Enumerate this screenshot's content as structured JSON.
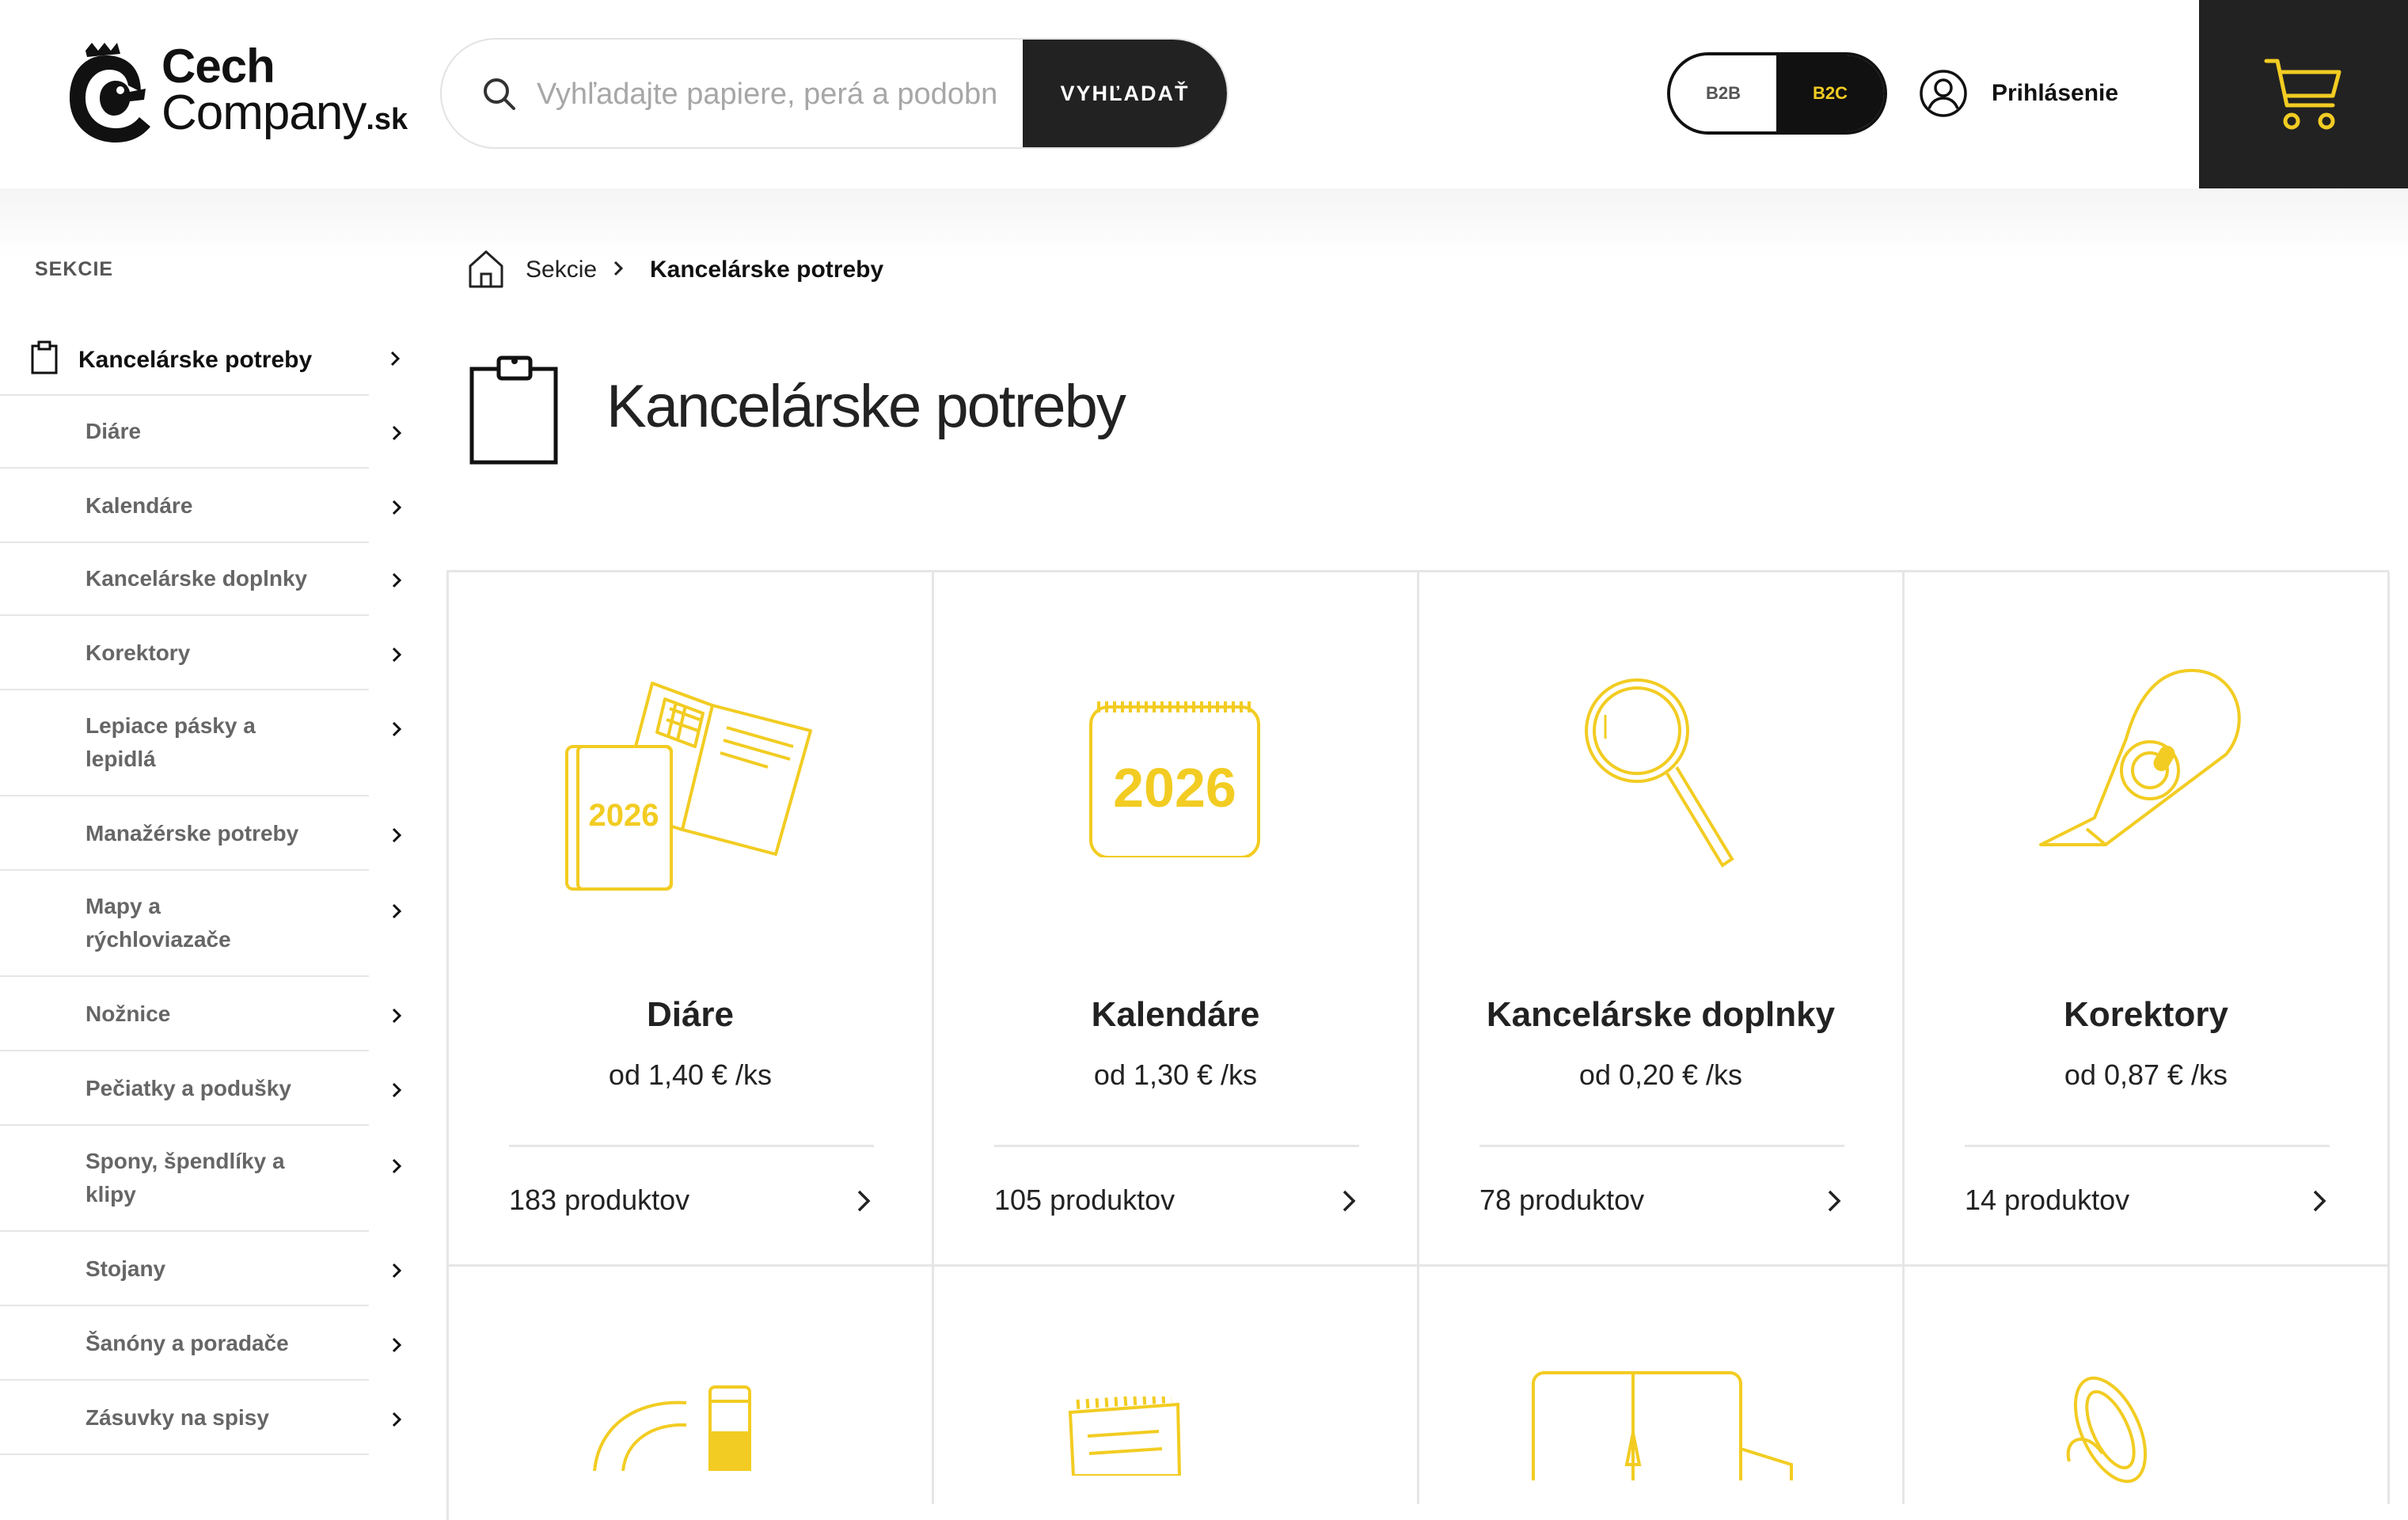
{
  "header": {
    "logo_line1": "Cech",
    "logo_line2": "Company",
    "logo_tld": ".sk",
    "search_placeholder": "Vyhľadajte papiere, perá a podobné",
    "search_button": "VYHĽADAŤ",
    "toggle_b2b": "B2B",
    "toggle_b2c": "B2C",
    "login_label": "Prihlásenie"
  },
  "sidebar": {
    "title": "SEKCIE",
    "active": "Kancelárske potreby",
    "items": [
      {
        "label": "Diáre"
      },
      {
        "label": "Kalendáre"
      },
      {
        "label": "Kancelárske doplnky"
      },
      {
        "label": "Korektory"
      },
      {
        "label": "Lepiace pásky a lepidlá"
      },
      {
        "label": "Manažérske potreby"
      },
      {
        "label": "Mapy a rýchloviazače"
      },
      {
        "label": "Nožnice"
      },
      {
        "label": "Pečiatky a podušky"
      },
      {
        "label": "Spony, špendlíky a klipy"
      },
      {
        "label": "Stojany"
      },
      {
        "label": "Šanóny a poradače"
      },
      {
        "label": "Zásuvky na spisy"
      }
    ]
  },
  "breadcrumb": {
    "sekcie": "Sekcie",
    "current": "Kancelárske potreby"
  },
  "page_title": "Kancelárske potreby",
  "cards": [
    {
      "title": "Diáre",
      "price": "od 1,40 € /ks",
      "count": "183 produktov",
      "image_year": "2026"
    },
    {
      "title": "Kalendáre",
      "price": "od 1,30 € /ks",
      "count": "105 produktov",
      "image_year": "2026"
    },
    {
      "title": "Kancelárske doplnky",
      "price": "od 0,20 € /ks",
      "count": "78 produktov"
    },
    {
      "title": "Korektory",
      "price": "od 0,87 € /ks",
      "count": "14 produktov"
    }
  ],
  "colors": {
    "accent_yellow": "#f2cc22",
    "dark": "#222222",
    "divider": "#e6e6e6"
  }
}
